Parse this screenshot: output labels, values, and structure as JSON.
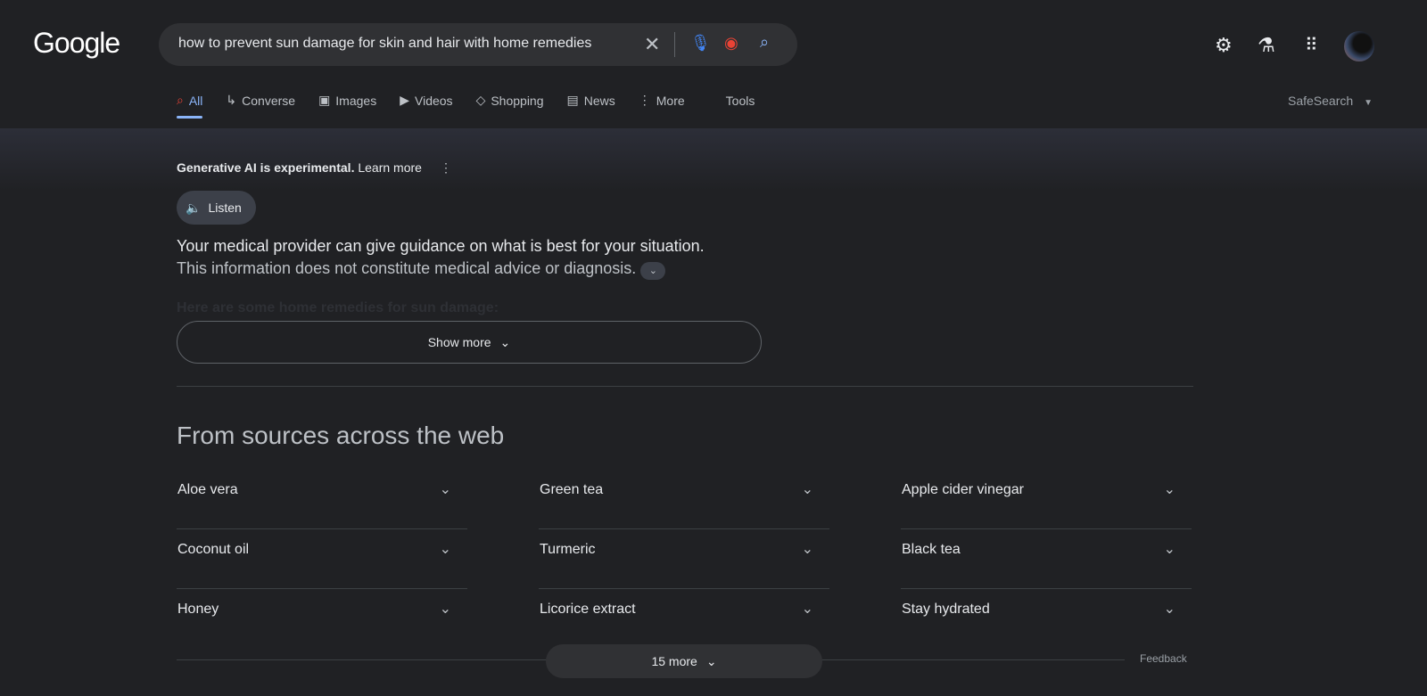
{
  "header": {
    "logo": "Google",
    "query": "how to prevent sun damage for skin and hair with home remedies"
  },
  "tabs": [
    {
      "label": "All",
      "icon": "search-icon"
    },
    {
      "label": "Converse",
      "icon": "arrow-icon"
    },
    {
      "label": "Images",
      "icon": "image-icon"
    },
    {
      "label": "Videos",
      "icon": "play-icon"
    },
    {
      "label": "Shopping",
      "icon": "tag-icon"
    },
    {
      "label": "News",
      "icon": "news-icon"
    },
    {
      "label": "More",
      "icon": "dots-icon"
    }
  ],
  "tools": "Tools",
  "safesearch": "SafeSearch",
  "ai": {
    "notice_bold": "Generative AI is experimental.",
    "learn_more": "Learn more",
    "listen": "Listen",
    "line1": "Your medical provider can give guidance on what is best for your situation.",
    "line2": "This information does not constitute medical advice or diagnosis.",
    "faded": "Here are some home remedies for sun damage:",
    "show_more": "Show more"
  },
  "sources": {
    "title": "From sources across the web",
    "items": [
      "Aloe vera",
      "Green tea",
      "Apple cider vinegar",
      "Coconut oil",
      "Turmeric",
      "Black tea",
      "Honey",
      "Licorice extract",
      "Stay hydrated"
    ],
    "more": "15 more",
    "feedback": "Feedback"
  }
}
